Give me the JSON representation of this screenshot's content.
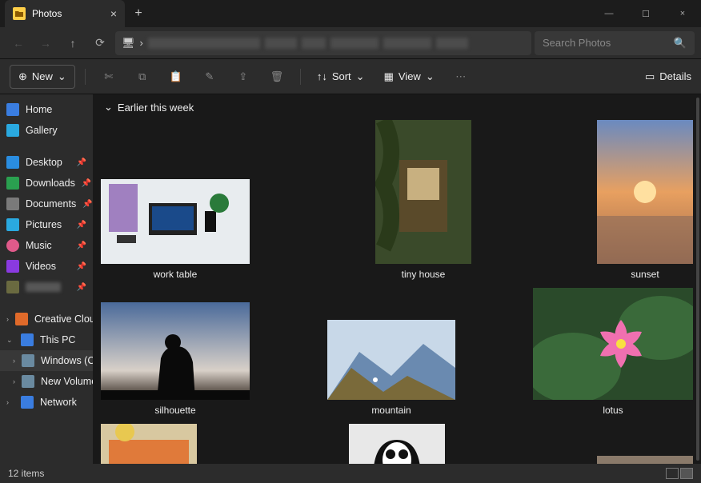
{
  "titlebar": {
    "tab_title": "Photos",
    "add_tab": "+",
    "close_glyph": "×",
    "min_glyph": "—",
    "max_glyph": "☐"
  },
  "nav": {
    "back": "←",
    "forward": "→",
    "up": "↑",
    "refresh": "⟳",
    "chevron": "›",
    "monitor_glyph": "🖥"
  },
  "search": {
    "placeholder": "Search Photos",
    "icon": "🔍"
  },
  "toolbar": {
    "new_label": "New",
    "new_plus": "⊕",
    "sort_label": "Sort",
    "view_label": "View",
    "details_label": "Details",
    "dropdown_glyph": "⌄",
    "updown_glyph": "↑↓",
    "more_glyph": "⋯"
  },
  "sidebar": {
    "home": "Home",
    "gallery": "Gallery",
    "desktop": "Desktop",
    "downloads": "Downloads",
    "documents": "Documents",
    "pictures": "Pictures",
    "music": "Music",
    "videos": "Videos",
    "ccf": "Creative Cloud Files",
    "thispc": "This PC",
    "cdrive": "Windows (C:)",
    "ddrive": "New Volume (D:)",
    "network": "Network",
    "pin_glyph": "📌",
    "exp_right": "›",
    "exp_down": "⌄"
  },
  "content": {
    "group_label": "Earlier this week",
    "group_chevron": "⌄",
    "thumbs": {
      "t1": "work table",
      "t2": "tiny house",
      "t3": "sunset",
      "t4": "silhouette",
      "t5": "mountain",
      "t6": "lotus"
    }
  },
  "status": {
    "count_label": "12 items"
  }
}
